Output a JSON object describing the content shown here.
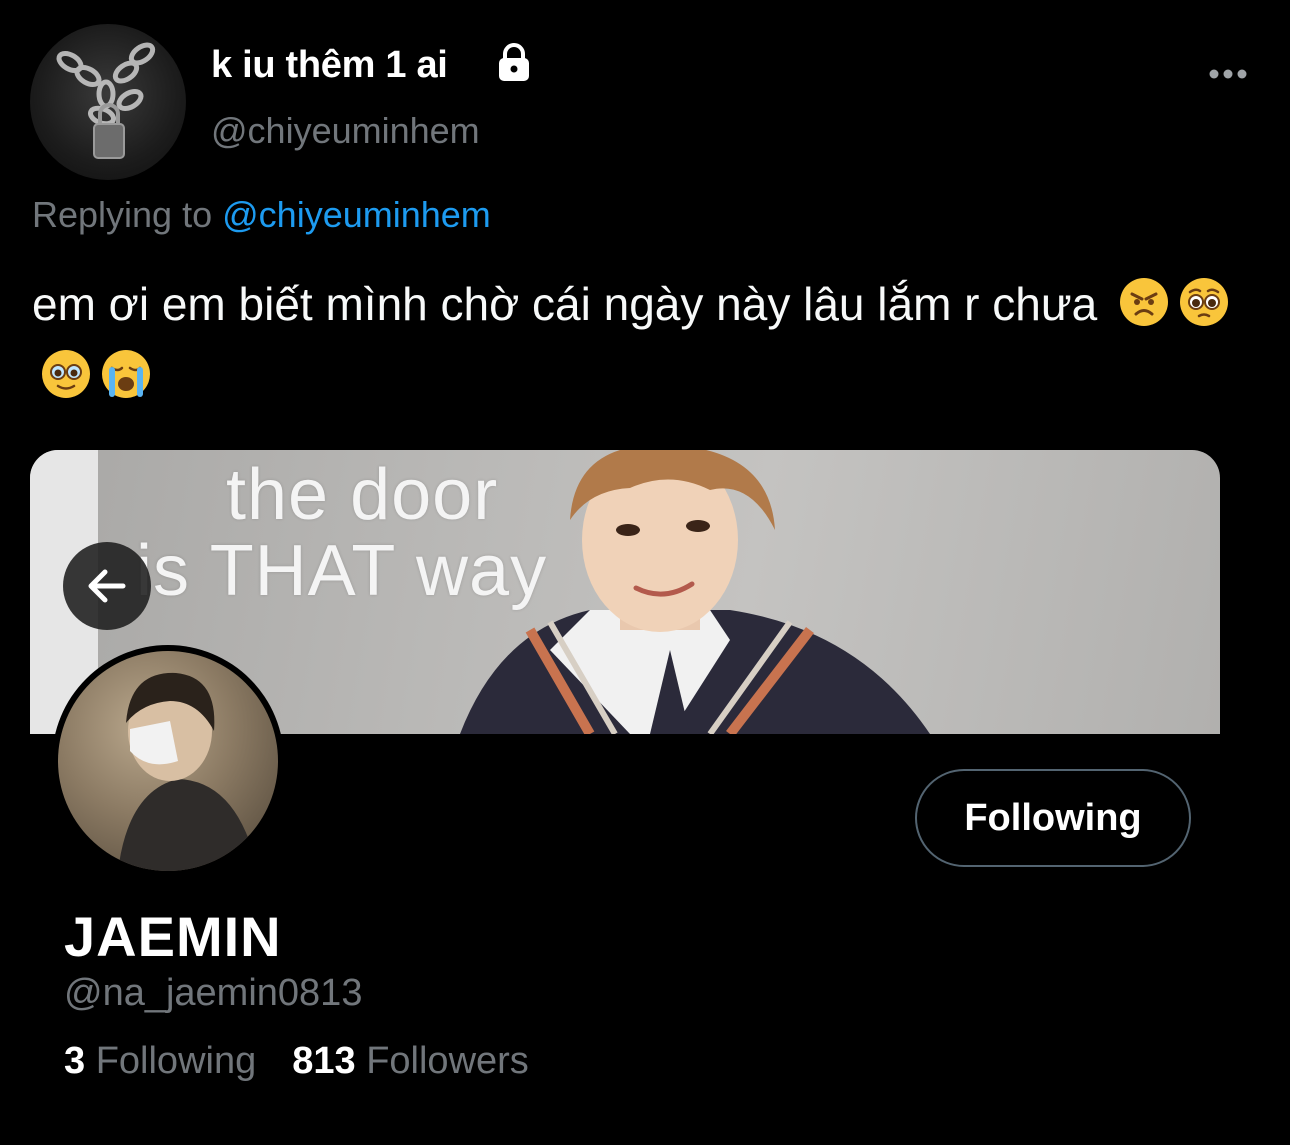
{
  "tweet": {
    "author": {
      "display_name": "k iu thêm 1 ai",
      "handle": "@chiyeuminhem",
      "protected_icon": "lock-icon"
    },
    "replying_prefix": "Replying to",
    "replying_to": "@chiyeuminhem",
    "text": "em ơi em biết mình chờ cái ngày này lâu lắm r chưa",
    "emojis": [
      "angry-face",
      "pleading-face",
      "face-holding-back-tears",
      "loudly-crying-face"
    ],
    "more_icon": "more-horizontal-icon"
  },
  "profile_card": {
    "banner_caption_line1": "the door",
    "banner_caption_line2": "is THAT way",
    "back_icon": "arrow-left-icon",
    "name": "JAEMIN",
    "handle": "@na_jaemin0813",
    "follow_button_label": "Following",
    "following_count": "3",
    "following_label": "Following",
    "followers_count": "813",
    "followers_label": "Followers"
  },
  "colors": {
    "background": "#000000",
    "primary_text": "#ffffff",
    "secondary_text": "#71767b",
    "link": "#1d9bf0",
    "button_border": "#536471"
  }
}
